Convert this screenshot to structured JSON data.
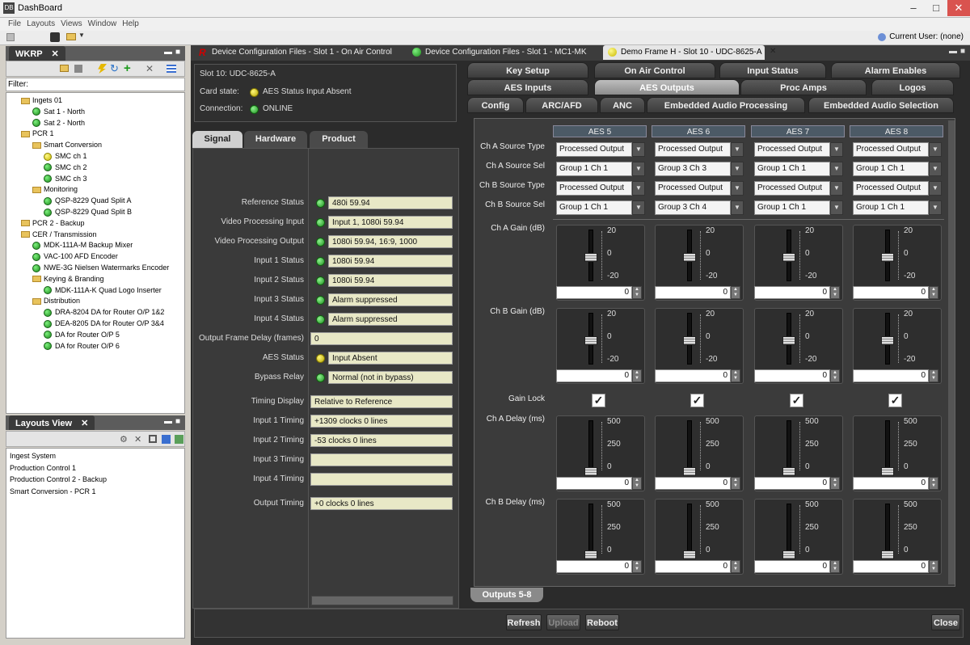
{
  "window": {
    "title": "DashBoard",
    "min": "–",
    "max": "□",
    "close": "✕"
  },
  "menu": [
    "File",
    "Layouts",
    "Views",
    "Window",
    "Help"
  ],
  "current_user": "Current User: (none)",
  "tree_panel": {
    "tab": "WKRP",
    "filter_label": "Filter:",
    "items": [
      {
        "label": "Ingets 01",
        "type": "folder",
        "indent": 0
      },
      {
        "label": "Sat 1 - North",
        "type": "green",
        "indent": 1
      },
      {
        "label": "Sat 2 - North",
        "type": "green",
        "indent": 1
      },
      {
        "label": "PCR 1",
        "type": "folder",
        "indent": 0
      },
      {
        "label": "Smart Conversion",
        "type": "folder",
        "indent": 1
      },
      {
        "label": "SMC ch 1",
        "type": "yellow",
        "indent": 2
      },
      {
        "label": "SMC ch 2",
        "type": "green",
        "indent": 2
      },
      {
        "label": "SMC ch 3",
        "type": "green",
        "indent": 2
      },
      {
        "label": "Monitoring",
        "type": "folder",
        "indent": 1
      },
      {
        "label": "QSP-8229 Quad Split A",
        "type": "green",
        "indent": 2
      },
      {
        "label": "QSP-8229 Quad Split B",
        "type": "green",
        "indent": 2
      },
      {
        "label": "PCR 2 - Backup",
        "type": "folder",
        "indent": 0
      },
      {
        "label": "CER / Transmission",
        "type": "folder",
        "indent": 0
      },
      {
        "label": "MDK-111A-M Backup Mixer",
        "type": "green",
        "indent": 1
      },
      {
        "label": "VAC-100 AFD Encoder",
        "type": "green",
        "indent": 1
      },
      {
        "label": "NWE-3G Nielsen Watermarks Encoder",
        "type": "green",
        "indent": 1
      },
      {
        "label": "Keying & Branding",
        "type": "folder",
        "indent": 1
      },
      {
        "label": "MDK-111A-K Quad Logo Inserter",
        "type": "green",
        "indent": 2
      },
      {
        "label": "Distribution",
        "type": "folder",
        "indent": 1
      },
      {
        "label": "DRA-8204 DA for Router O/P 1&2",
        "type": "green",
        "indent": 2
      },
      {
        "label": "DEA-8205 DA for Router O/P 3&4",
        "type": "green",
        "indent": 2
      },
      {
        "label": "DA for Router O/P 5",
        "type": "green",
        "indent": 2
      },
      {
        "label": "DA for Router O/P 6",
        "type": "green",
        "indent": 2
      }
    ]
  },
  "layouts_panel": {
    "tab": "Layouts View",
    "items": [
      "Ingest System",
      "Production Control 1",
      "Production Control 2 - Backup",
      "Smart Conversion - PCR 1"
    ]
  },
  "doc_tabs": [
    {
      "label": "Device Configuration Files - Slot 1 - On Air Control",
      "dot": "#c00000"
    },
    {
      "label": "Device Configuration Files - Slot 1 - MC1-MK",
      "dot": "#22aa22"
    },
    {
      "label": "Demo Frame H - Slot 10 - UDC-8625-A",
      "dot": "#e8d800"
    }
  ],
  "slot": {
    "name": "Slot 10: UDC-8625-A",
    "card_state_label": "Card state:",
    "card_state": "AES Status Input Absent",
    "connection_label": "Connection:",
    "connection": "ONLINE"
  },
  "left_tabs": [
    "Signal",
    "Hardware",
    "Product"
  ],
  "signal_rows": [
    {
      "label": "Reference Status",
      "value": "480i 59.94",
      "led": "green"
    },
    {
      "label": "Video Processing Input",
      "value": "Input 1, 1080i 59.94",
      "led": "green"
    },
    {
      "label": "Video Processing Output",
      "value": "1080i 59.94, 16:9, 1000",
      "led": "green"
    },
    {
      "label": "Input 1 Status",
      "value": "1080i 59.94",
      "led": "green"
    },
    {
      "label": "Input 2 Status",
      "value": "1080i 59.94",
      "led": "green"
    },
    {
      "label": "Input 3 Status",
      "value": "Alarm suppressed",
      "led": "green"
    },
    {
      "label": "Input 4 Status",
      "value": "Alarm suppressed",
      "led": "green"
    },
    {
      "label": "Output Frame Delay (frames)",
      "value": "0",
      "led": ""
    },
    {
      "label": "AES Status",
      "value": "Input Absent",
      "led": "yellow"
    },
    {
      "label": "Bypass Relay",
      "value": "Normal (not in bypass)",
      "led": "green"
    },
    {
      "label": "Timing Display",
      "value": "Relative to Reference",
      "led": ""
    },
    {
      "label": "Input 1 Timing",
      "value": "+1309 clocks 0 lines",
      "led": ""
    },
    {
      "label": "Input 2 Timing",
      "value": "-53 clocks 0 lines",
      "led": ""
    },
    {
      "label": "Input 3 Timing",
      "value": "",
      "led": ""
    },
    {
      "label": "Input 4 Timing",
      "value": "",
      "led": ""
    },
    {
      "label": "Output Timing",
      "value": "+0 clocks 0 lines",
      "led": ""
    }
  ],
  "right_tabs_row1": [
    "Key Setup",
    "On Air Control",
    "Input Status",
    "Alarm Enables"
  ],
  "right_tabs_row2": [
    "AES Inputs",
    "AES Outputs",
    "Proc Amps",
    "Logos"
  ],
  "right_tabs_row3": [
    "Config",
    "ARC/AFD",
    "ANC",
    "Embedded Audio Processing",
    "Embedded Audio Selection"
  ],
  "active_right_tab": "AES Outputs",
  "aes": {
    "channels": [
      "AES 5",
      "AES 6",
      "AES 7",
      "AES 8"
    ],
    "row_labels": {
      "cha_src_type": "Ch A Source Type",
      "cha_src_sel": "Ch A Source Sel",
      "chb_src_type": "Ch B Source Type",
      "chb_src_sel": "Ch B Source Sel",
      "cha_gain": "Ch A Gain (dB)",
      "chb_gain": "Ch B Gain (dB)",
      "gain_lock": "Gain Lock",
      "cha_delay": "Ch A Delay (ms)",
      "chb_delay": "Ch B Delay (ms)"
    },
    "cha_src_type": [
      "Processed Output",
      "Processed Output",
      "Processed Output",
      "Processed Output"
    ],
    "cha_src_sel": [
      "Group 1 Ch 1",
      "Group 3 Ch 3",
      "Group 1 Ch 1",
      "Group 1 Ch 1"
    ],
    "chb_src_type": [
      "Processed Output",
      "Processed Output",
      "Processed Output",
      "Processed Output"
    ],
    "chb_src_sel": [
      "Group 1 Ch 1",
      "Group 3 Ch 4",
      "Group 1 Ch 1",
      "Group 1 Ch 1"
    ],
    "gain_ticks": [
      "20",
      "0",
      "-20"
    ],
    "delay_ticks": [
      "500",
      "250",
      "0"
    ],
    "cha_gain": [
      "0",
      "0",
      "0",
      "0"
    ],
    "chb_gain": [
      "0",
      "0",
      "0",
      "0"
    ],
    "cha_delay": [
      "0",
      "0",
      "0",
      "0"
    ],
    "chb_delay": [
      "0",
      "0",
      "0",
      "0"
    ],
    "gain_lock": [
      true,
      true,
      true,
      true
    ]
  },
  "bottom_tab": "Outputs 5-8",
  "buttons": {
    "refresh": "Refresh",
    "upload": "Upload",
    "reboot": "Reboot",
    "close": "Close"
  }
}
